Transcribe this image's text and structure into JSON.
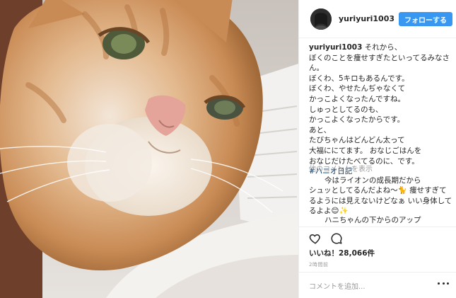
{
  "post": {
    "username": "yuriyuri1003",
    "follow_label": "フォローする"
  },
  "caption": {
    "username": "yuriyuri1003",
    "first_line_text": " それから、",
    "lines": [
      "ぼくのことを痩せすぎたといってるみなさ",
      "ん。",
      "ぼくわ、5キロもあるんです。",
      "ぼくわ、やせたんぢゃなくて",
      "かっこよくなったんですね。",
      "しゅっとしてるのも、",
      "かっこよくなったからです。",
      "あと、",
      "たびちゃんはどんどん太って",
      "大福ににてます。 おなじごはんを",
      "おなじだけたべてるのに、です。"
    ],
    "hashtag": "#ハニオ日記"
  },
  "more_comments_label": "他のコメントを表示",
  "comments": [
    {
      "lines": [
        "今はライオンの成長期だから",
        "シュッとしてるんだよね〜🐈 痩せすぎて",
        "るようには見えないけどなぁ いい身体して",
        "るよよ😊✨"
      ]
    },
    {
      "lines": [
        "ハニちゃんの下からのアップ"
      ]
    }
  ],
  "likes_label": "いいね！28,066件",
  "time_label": "2時間前",
  "add_comment_placeholder": "コメントを追加...",
  "icons": {
    "like": "heart-icon",
    "comment": "comment-bubble-icon",
    "options": "more-options-icon"
  },
  "colors": {
    "follow_button": "#3897f0",
    "hashtag": "#003569",
    "muted_text": "#999999"
  }
}
